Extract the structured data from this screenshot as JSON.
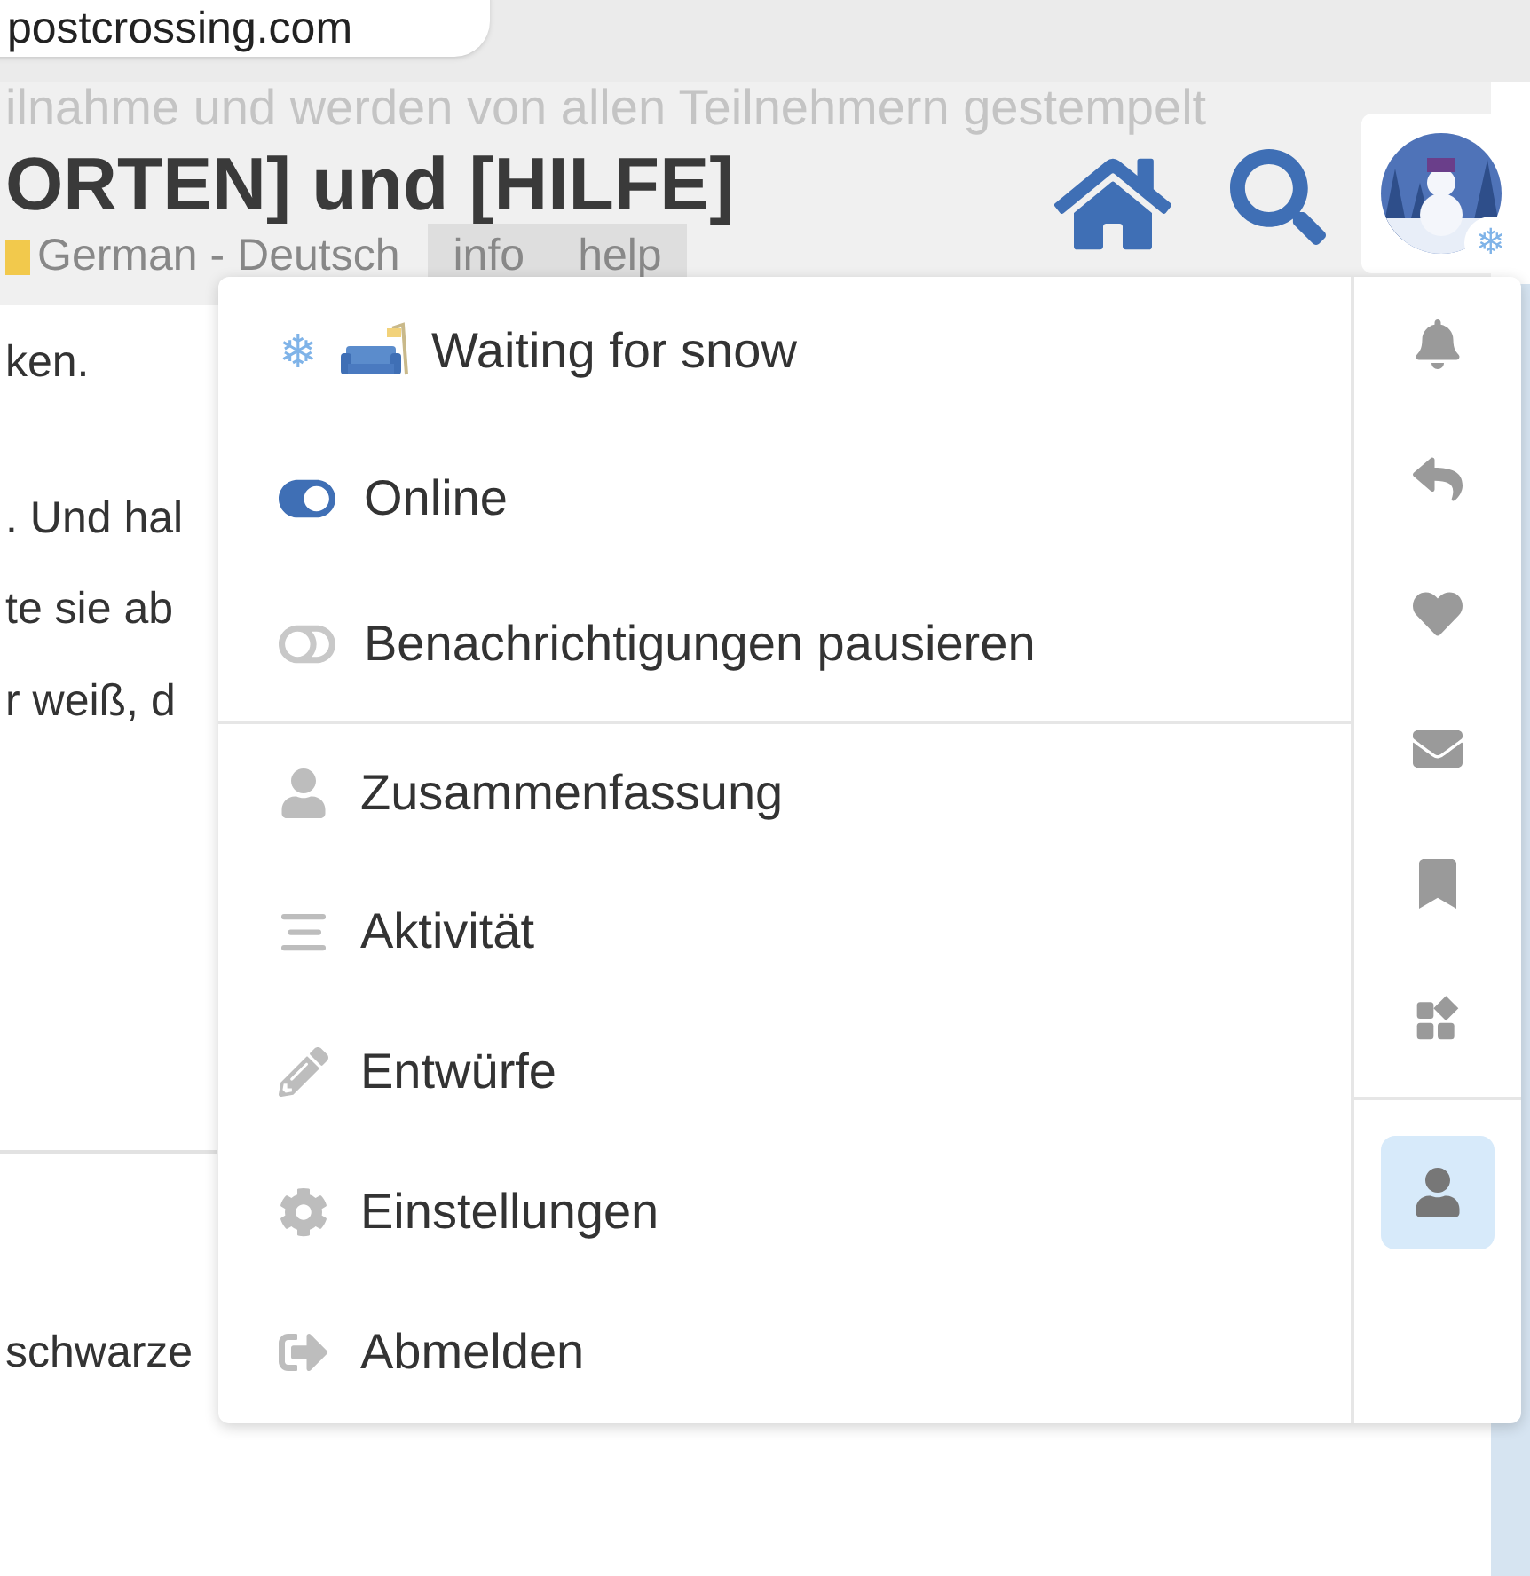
{
  "browser": {
    "url": "postcrossing.com"
  },
  "background": {
    "ghost_lines": [
      "ilnahme und werden von allen Teilnehmern gestempelt"
    ],
    "title": "ORTEN] und [HILFE]",
    "language": "German - Deutsch",
    "tags": [
      "info",
      "help"
    ],
    "body_lines": [
      "ken.",
      ". Und hal",
      "te sie ab",
      "r weiß, d"
    ],
    "footer_text": "schwarze"
  },
  "header": {
    "avatar_badge": "❄"
  },
  "menu": {
    "status": {
      "emoji": "❄",
      "text": "Waiting for snow"
    },
    "items": [
      {
        "kind": "toggle",
        "label": "Online",
        "on": true
      },
      {
        "kind": "toggle",
        "label": "Benachrichtigungen pausieren",
        "on": false
      },
      {
        "kind": "summary",
        "label": "Zusammenfassung"
      },
      {
        "kind": "activity",
        "label": "Aktivität"
      },
      {
        "kind": "drafts",
        "label": "Entwürfe"
      },
      {
        "kind": "preferences",
        "label": "Einstellungen"
      },
      {
        "kind": "logout",
        "label": "Abmelden"
      }
    ],
    "tabs": [
      {
        "kind": "notifications",
        "selected": false
      },
      {
        "kind": "replies",
        "selected": false
      },
      {
        "kind": "likes",
        "selected": false
      },
      {
        "kind": "messages",
        "selected": false
      },
      {
        "kind": "bookmarks",
        "selected": false
      },
      {
        "kind": "other",
        "selected": false
      },
      {
        "kind": "profile",
        "selected": true
      }
    ]
  }
}
